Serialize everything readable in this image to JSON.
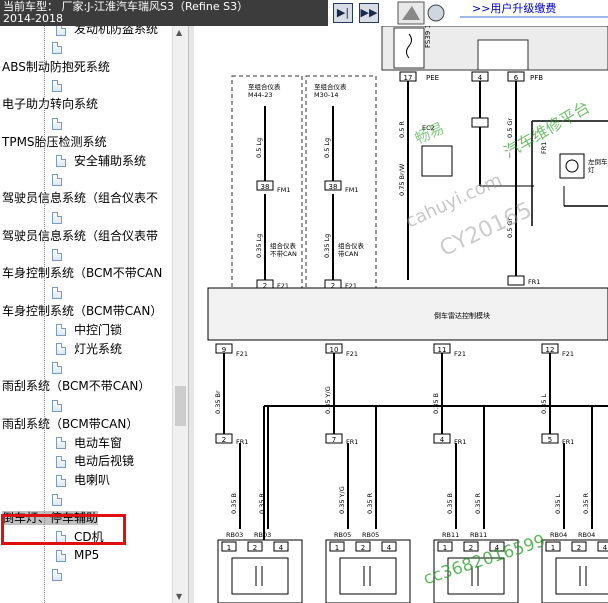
{
  "header": {
    "vehicle_line1": "当前车型：  厂家:J-江淮汽车瑞风S3（Refine S3）",
    "vehicle_line2": "2014-2018",
    "upgrade_link": ">>用户升级缴费"
  },
  "tree": {
    "items": [
      {
        "label": "发动机防盗系统",
        "level": 1
      },
      {
        "label": "",
        "level": 0
      },
      {
        "label": "ABS制动防抱死系统",
        "level": 0
      },
      {
        "label": "",
        "level": 0
      },
      {
        "label": "电子助力转向系统",
        "level": 0
      },
      {
        "label": "",
        "level": 0
      },
      {
        "label": "TPMS胎压检测系统",
        "level": 0
      },
      {
        "label": "安全辅助系统",
        "level": 1
      },
      {
        "label": "",
        "level": 0
      },
      {
        "label": "驾驶员信息系统（组合仪表不",
        "level": 0
      },
      {
        "label": "",
        "level": 0
      },
      {
        "label": "驾驶员信息系统（组合仪表带",
        "level": 0
      },
      {
        "label": "",
        "level": 0
      },
      {
        "label": "车身控制系统（BCM不带CAN",
        "level": 0
      },
      {
        "label": "",
        "level": 0
      },
      {
        "label": "车身控制系统（BCM带CAN）",
        "level": 0
      },
      {
        "label": "中控门锁",
        "level": 1
      },
      {
        "label": "灯光系统",
        "level": 1
      },
      {
        "label": "",
        "level": 0
      },
      {
        "label": "雨刮系统（BCM不带CAN）",
        "level": 0
      },
      {
        "label": "",
        "level": 0
      },
      {
        "label": "雨刮系统（BCM带CAN）",
        "level": 0
      },
      {
        "label": "电动车窗",
        "level": 1
      },
      {
        "label": "电动后视镜",
        "level": 1
      },
      {
        "label": "电喇叭",
        "level": 1
      },
      {
        "label": "",
        "level": 0
      },
      {
        "label": "倒车灯、停车辅助",
        "level": 0,
        "selected": true
      },
      {
        "label": "CD机",
        "level": 1
      },
      {
        "label": "MP5",
        "level": 1
      },
      {
        "label": "",
        "level": 0
      }
    ]
  },
  "diagram": {
    "fuse": "FS39 10A",
    "dashbox1_title": "至组合仪表\nM44-23",
    "dashbox2_title": "至组合仪表\nM30-14",
    "wire_05lg": "0.5 Lg",
    "wire_035lg": "0.35 Lg",
    "conn_fm1": "FM1",
    "conn_f21": "F21",
    "conn_38": "38",
    "conn_2": "2",
    "label_nocan": "组合仪表\n不带CAN",
    "label_can": "组合仪表\n带CAN",
    "pin_17": "17",
    "pin_4": "4",
    "pin_6": "6",
    "pee": "PEE",
    "pfb": "PFB",
    "wire_05r": "0.5 R",
    "wire_05gr": "0.5 Gr",
    "wire_075brw": "0.75 Br/W",
    "ec2": "EC2",
    "fr1": "FR1",
    "right_lamp": "左倒车\n灯",
    "module_label": "倒车雷达控制模块",
    "pins_top": [
      "9",
      "10",
      "11",
      "12"
    ],
    "pins_f21": [
      "F21",
      "F21",
      "F21",
      "F21"
    ],
    "wire_b1": [
      "0.35 Br",
      "0.35 Y/G",
      "0.35 B",
      "0.35 L"
    ],
    "pins_mid": [
      "2",
      "7",
      "4",
      "5"
    ],
    "fr1_mid": [
      "FR1",
      "FR1",
      "FR1",
      "FR1"
    ],
    "wire_b2": [
      "0.35 B",
      "0.35 R",
      "0.35 Y/G",
      "0.35 R",
      "0.35 B",
      "0.35 R",
      "0.35 L",
      "0.35 R"
    ],
    "rb": [
      "RB03",
      "RB03",
      "RB05",
      "RB05",
      "RB11",
      "RB11",
      "RB04",
      "RB04"
    ],
    "sensor_pins": [
      "1",
      "2",
      "4",
      "1",
      "2",
      "4",
      "1",
      "2",
      "4",
      "1",
      "2",
      "4"
    ],
    "watermark1": "畅易",
    "watermark2": "汽车维修平台",
    "watermark3": "cahuyi.com",
    "watermark4": "CY20165",
    "watermark5": "cc3682016599"
  }
}
